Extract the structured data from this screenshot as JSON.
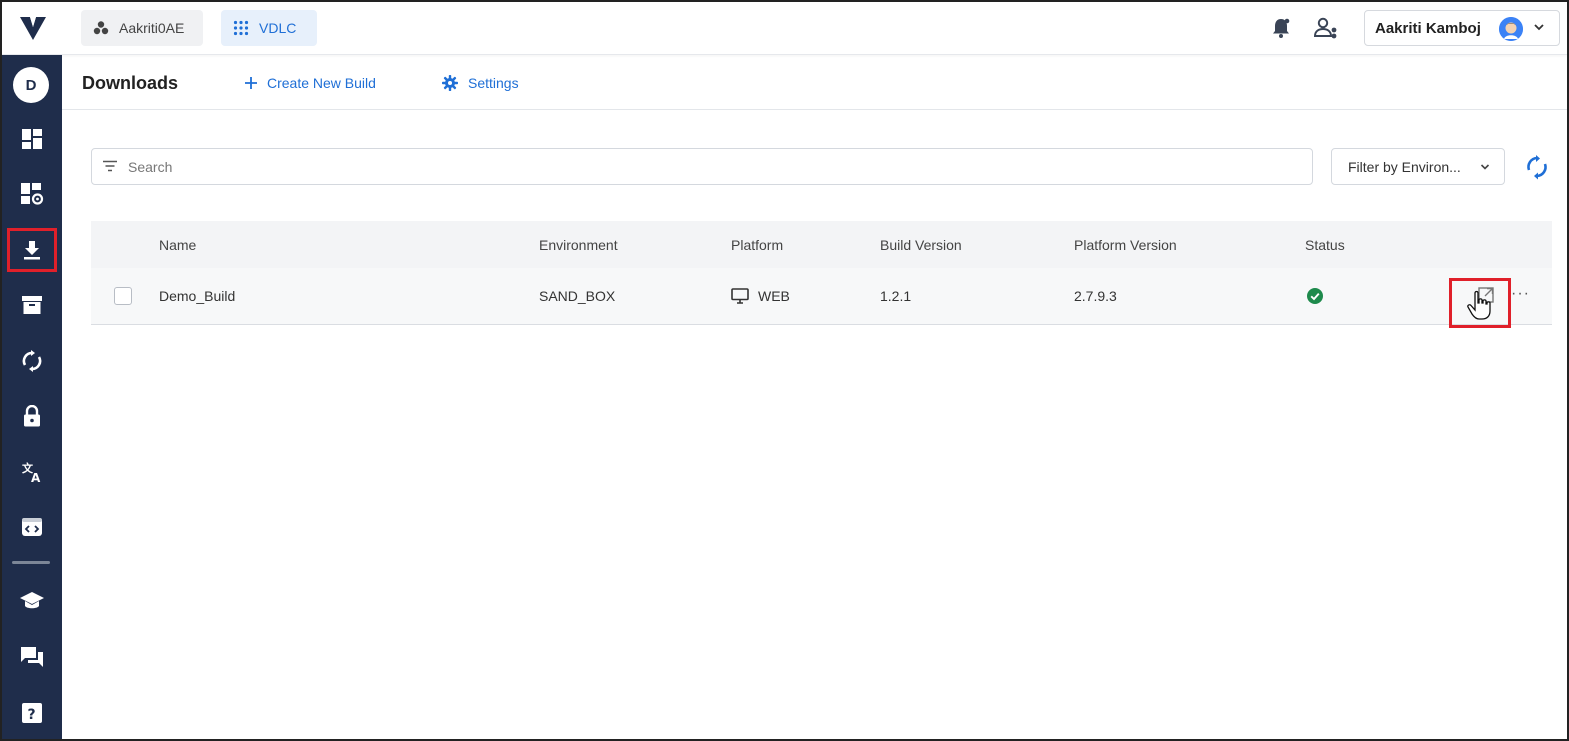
{
  "topbar": {
    "workspace_1": "Aakriti0AE",
    "workspace_2": "VDLC",
    "user_name": "Aakriti Kamboj"
  },
  "sidebar": {
    "avatar_letter": "D",
    "items": [
      {
        "icon": "dashboard-icon"
      },
      {
        "icon": "dashboard-settings-icon"
      },
      {
        "icon": "download-icon",
        "active": true
      },
      {
        "icon": "archive-icon"
      },
      {
        "icon": "sync-icon"
      },
      {
        "icon": "lock-icon"
      },
      {
        "icon": "translate-icon"
      },
      {
        "icon": "code-window-icon"
      },
      {
        "icon": "graduation-cap-icon"
      },
      {
        "icon": "chat-icon"
      },
      {
        "icon": "help-icon"
      }
    ]
  },
  "subheader": {
    "title": "Downloads",
    "create_label": "Create New Build",
    "settings_label": "Settings"
  },
  "search": {
    "placeholder": "Search",
    "filter_label": "Filter by Environ..."
  },
  "table": {
    "headers": {
      "name": "Name",
      "environment": "Environment",
      "platform": "Platform",
      "build_version": "Build Version",
      "platform_version": "Platform Version",
      "status": "Status"
    },
    "rows": [
      {
        "name": "Demo_Build",
        "environment": "SAND_BOX",
        "platform": "WEB",
        "build_version": "1.2.1",
        "platform_version": "2.7.9.3",
        "status": "success"
      }
    ],
    "more_label": "···"
  },
  "colors": {
    "accent": "#1f6fd6",
    "sidebar": "#1f2d4b",
    "highlight": "#e0202a",
    "success": "#1e8a4c"
  }
}
